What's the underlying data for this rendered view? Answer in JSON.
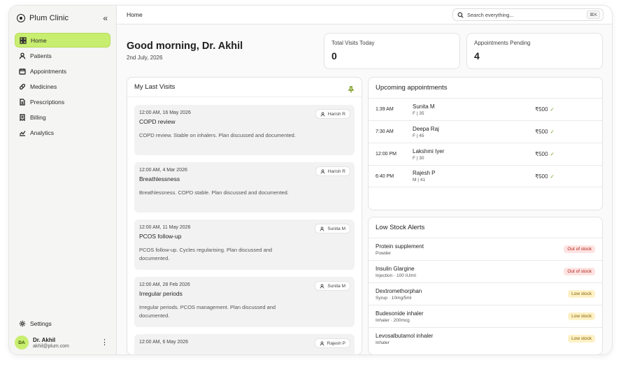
{
  "app": {
    "name": "Plum Clinic",
    "collapse_icon": "«"
  },
  "sidebar": {
    "items": [
      {
        "label": "Home",
        "icon": "grid-icon"
      },
      {
        "label": "Patients",
        "icon": "user-icon"
      },
      {
        "label": "Appointments",
        "icon": "calendar-icon"
      },
      {
        "label": "Medicines",
        "icon": "pill-icon"
      },
      {
        "label": "Prescriptions",
        "icon": "document-icon"
      },
      {
        "label": "Billing",
        "icon": "receipt-icon"
      },
      {
        "label": "Analytics",
        "icon": "chart-icon"
      }
    ],
    "settings_label": "Settings",
    "user": {
      "initials": "DA",
      "name": "Dr. Akhil",
      "email": "akhil@plum.com",
      "menu": "⋮"
    }
  },
  "header": {
    "breadcrumb": "Home",
    "search_placeholder": "Search everything...",
    "search_shortcut": "⌘K"
  },
  "greeting": {
    "title": "Good morning, Dr. Akhil",
    "date": "2nd July, 2026"
  },
  "stats": [
    {
      "label": "Total Visits Today",
      "value": "0"
    },
    {
      "label": "Appointments Pending",
      "value": "4"
    }
  ],
  "last_visits": {
    "title": "My Last Visits",
    "items": [
      {
        "time": "12:00 AM, 16 May 2026",
        "doctor": "Harish R",
        "title": "COPD review",
        "note": "COPD review. Stable on inhalers. Plan discussed and documented."
      },
      {
        "time": "12:00 AM, 4 Mar 2026",
        "doctor": "Harish R",
        "title": "Breathlessness",
        "note": "Breathlessness. COPD stable. Plan discussed and documented."
      },
      {
        "time": "12:00 AM, 11 May 2026",
        "doctor": "Sunita M",
        "title": "PCOS follow-up",
        "note": "PCOS follow-up. Cycles regularising. Plan discussed and documented."
      },
      {
        "time": "12:00 AM, 28 Feb 2026",
        "doctor": "Sunita M",
        "title": "Irregular periods",
        "note": "Irregular periods. PCOS management. Plan discussed and documented."
      },
      {
        "time": "12:00 AM, 6 May 2026",
        "doctor": "Rajesh P",
        "title": "",
        "note": ""
      }
    ]
  },
  "upcoming": {
    "title": "Upcoming appointments",
    "items": [
      {
        "time": "1:39 AM",
        "name": "Sunita M",
        "meta": "F | 35",
        "fee": "₹500",
        "check": "✓"
      },
      {
        "time": "7:30 AM",
        "name": "Deepa Raj",
        "meta": "F | 45",
        "fee": "₹500",
        "check": "✓"
      },
      {
        "time": "12:00 PM",
        "name": "Lakshmi Iyer",
        "meta": "F | 30",
        "fee": "₹500",
        "check": "✓"
      },
      {
        "time": "6:40 PM",
        "name": "Rajesh P",
        "meta": "M | 41",
        "fee": "₹500",
        "check": "✓"
      }
    ]
  },
  "stock": {
    "title": "Low Stock Alerts",
    "colors": {
      "out_bg": "#fde3e1",
      "out_fg": "#b4231a",
      "low_bg": "#fdf1c6",
      "low_fg": "#8a6300"
    },
    "items": [
      {
        "name": "Protein supplement",
        "sub": "Powder",
        "status": "Out of stock",
        "level": "out"
      },
      {
        "name": "Insulin Glargine",
        "sub": "Injection · 100 IU/ml",
        "status": "Out of stock",
        "level": "out"
      },
      {
        "name": "Dextromethorphan",
        "sub": "Syrup · 10mg/5ml",
        "status": "Low stock",
        "level": "low"
      },
      {
        "name": "Budesonide inhaler",
        "sub": "Inhaler · 200mcg",
        "status": "Low stock",
        "level": "low"
      },
      {
        "name": "Levosalbutamol inhaler",
        "sub": "Inhaler",
        "status": "Low stock",
        "level": "low"
      }
    ]
  },
  "theme": {
    "accent": "#c8ee6f"
  }
}
